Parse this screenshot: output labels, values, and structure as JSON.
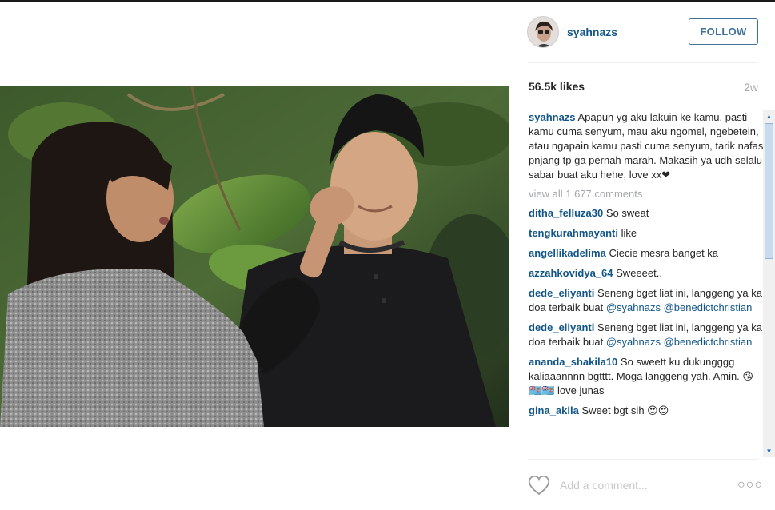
{
  "post": {
    "username": "syahnazs",
    "follow_label": "FOLLOW",
    "likes": "56.5k likes",
    "age": "2w"
  },
  "caption": {
    "username": "syahnazs",
    "text": "Apapun yg aku lakuin ke kamu, pasti kamu cuma senyum, mau aku ngomel, ngebetein, atau ngapain kamu pasti cuma senyum, tarik nafas pnjang tp ga pernah marah. Makasih ya udh selalu sabar buat aku hehe, love xx❤"
  },
  "view_all": "view all 1,677 comments",
  "comments": [
    {
      "user": "ditha_felluza30",
      "text": "So sweat"
    },
    {
      "user": "tengkurahmayanti",
      "text": "like"
    },
    {
      "user": "angellikadelima",
      "text": "Ciecie mesra banget ka"
    },
    {
      "user": "azzahkovidya_64",
      "text": "Sweeeet.."
    },
    {
      "user": "dede_eliyanti",
      "text": "Seneng bget liat ini, langgeng ya ka doa terbaik buat",
      "mentions": [
        "@syahnazs",
        "@benedictchristian"
      ]
    },
    {
      "user": "dede_eliyanti",
      "text": "Seneng bget liat ini, langgeng ya ka doa terbaik buat",
      "mentions": [
        "@syahnazs",
        "@benedictchristian"
      ]
    },
    {
      "user": "ananda_shakila10",
      "text": "So sweett ku dukungggg kaliaaannnn bgtttt. Moga langgeng yah. Amin. 😘🇫🇯🇫🇯 love junas"
    },
    {
      "user": "gina_akila",
      "text": "Sweet bgt sih 😍😍"
    }
  ],
  "footer": {
    "comment_placeholder": "Add a comment...",
    "more_label": "○○○"
  },
  "icons": {
    "heart": "heart-icon",
    "avatar": "avatar",
    "more": "more-options-icon"
  },
  "colors": {
    "link_blue": "#125688",
    "follow_blue": "#3f729b",
    "muted_gray": "#a5a7aa"
  }
}
